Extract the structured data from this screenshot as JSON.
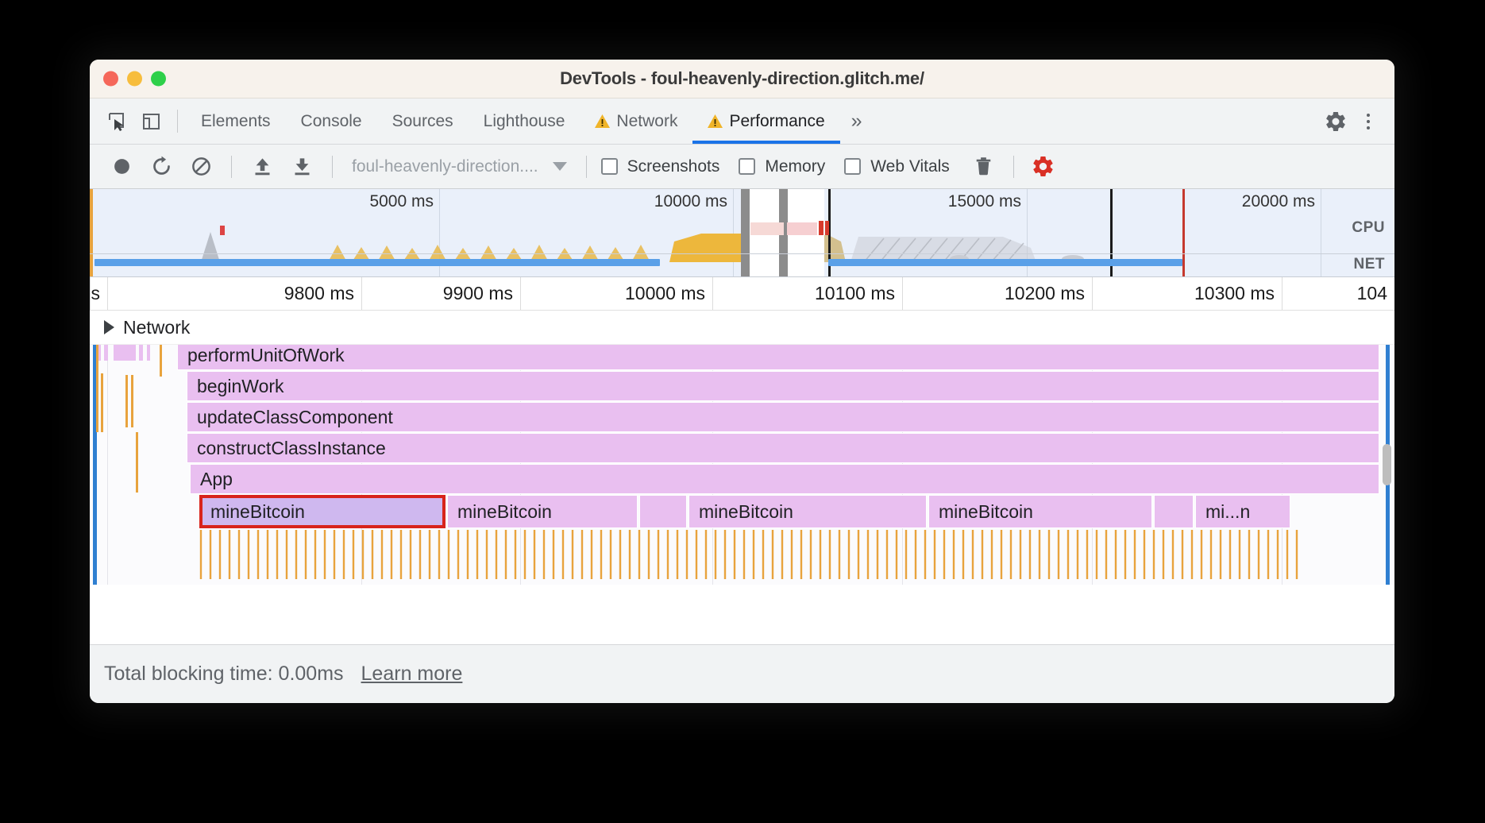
{
  "window": {
    "title": "DevTools - foul-heavenly-direction.glitch.me/",
    "traffic_lights": [
      "close",
      "minimize",
      "maximize"
    ]
  },
  "tabstrip": {
    "left_icons": [
      {
        "name": "inspect-element-icon",
        "label": "Inspect element"
      },
      {
        "name": "device-toolbar-icon",
        "label": "Toggle device toolbar"
      }
    ],
    "tabs": [
      {
        "label": "Elements",
        "warning": false,
        "active": false
      },
      {
        "label": "Console",
        "warning": false,
        "active": false
      },
      {
        "label": "Sources",
        "warning": false,
        "active": false
      },
      {
        "label": "Lighthouse",
        "warning": false,
        "active": false
      },
      {
        "label": "Network",
        "warning": true,
        "active": false
      },
      {
        "label": "Performance",
        "warning": true,
        "active": true
      }
    ],
    "more_tabs": "»",
    "settings_icon": "gear-icon",
    "menu_icon": "kebab-menu-icon"
  },
  "perf_toolbar": {
    "record_label": "Record",
    "reload_label": "Start profiling and reload page",
    "clear_label": "Clear",
    "load_label": "Load profile",
    "save_label": "Save profile",
    "url_value": "foul-heavenly-direction....",
    "checkboxes": [
      {
        "label": "Screenshots",
        "checked": false
      },
      {
        "label": "Memory",
        "checked": false
      },
      {
        "label": "Web Vitals",
        "checked": false
      }
    ],
    "trash_label": "Delete",
    "capture_settings_label": "Capture settings"
  },
  "overview": {
    "ticks": [
      "5000 ms",
      "10000 ms",
      "15000 ms",
      "20000 ms"
    ],
    "lane_labels": [
      "CPU",
      "NET"
    ],
    "partial_tick_text": "10000 ms"
  },
  "main_ruler": {
    "ticks": [
      "ms",
      "9800 ms",
      "9900 ms",
      "10000 ms",
      "10100 ms",
      "10200 ms",
      "10300 ms",
      "104"
    ]
  },
  "network_group": {
    "label": "Network",
    "expander": "▶"
  },
  "flame_chart": {
    "rows": [
      {
        "label": "performUnitOfWork"
      },
      {
        "label": "beginWork"
      },
      {
        "label": "updateClassComponent"
      },
      {
        "label": "constructClassInstance"
      },
      {
        "label": "App"
      }
    ],
    "mine_row": [
      {
        "label": "mineBitcoin",
        "selected": true
      },
      {
        "label": "mineBitcoin",
        "selected": false
      },
      {
        "label": "mineBitcoin",
        "selected": false
      },
      {
        "label": "mineBitcoin",
        "selected": false
      },
      {
        "label": "mi...n",
        "selected": false
      }
    ],
    "colors": {
      "bar": "#e9bff0",
      "bar_selected": "#cfb8ef",
      "selection_outline": "#d8241c",
      "tick_marker": "#e8a33d",
      "edge_line": "#2f7fd1"
    }
  },
  "status_bar": {
    "text": "Total blocking time: 0.00ms",
    "link": "Learn more"
  }
}
